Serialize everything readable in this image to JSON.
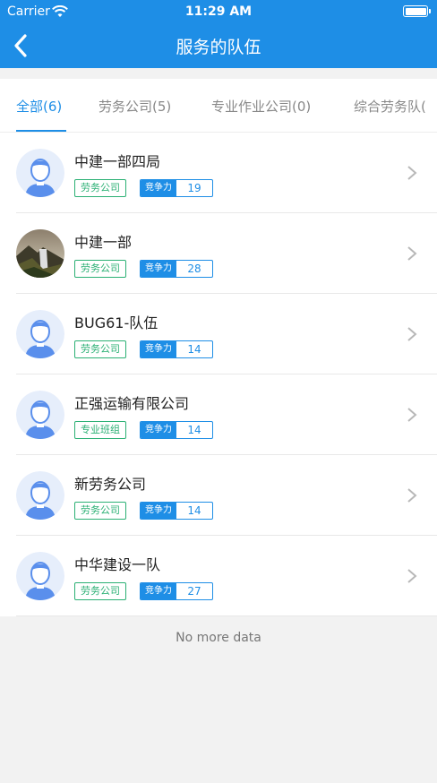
{
  "status_bar": {
    "carrier": "Carrier",
    "time": "11:29 AM"
  },
  "nav": {
    "title": "服务的队伍"
  },
  "tabs": [
    {
      "label": "全部(6)",
      "active": true
    },
    {
      "label": "劳务公司(5)",
      "active": false
    },
    {
      "label": "专业作业公司(0)",
      "active": false
    },
    {
      "label": "综合劳务队(",
      "active": false
    }
  ],
  "teams": [
    {
      "name": "中建一部四局",
      "tag": "劳务公司",
      "comp_label": "竞争力",
      "score": "19",
      "avatar": "person-icon"
    },
    {
      "name": "中建一部",
      "tag": "劳务公司",
      "comp_label": "竞争力",
      "score": "28",
      "avatar": "photo"
    },
    {
      "name": "BUG61-队伍",
      "tag": "劳务公司",
      "comp_label": "竞争力",
      "score": "14",
      "avatar": "person-icon"
    },
    {
      "name": "正强运输有限公司",
      "tag": "专业班组",
      "comp_label": "竞争力",
      "score": "14",
      "avatar": "person-icon"
    },
    {
      "name": "新劳务公司",
      "tag": "劳务公司",
      "comp_label": "竞争力",
      "score": "14",
      "avatar": "person-icon"
    },
    {
      "name": "中华建设一队",
      "tag": "劳务公司",
      "comp_label": "竞争力",
      "score": "27",
      "avatar": "person-icon"
    }
  ],
  "footer": {
    "text": "No more data"
  },
  "colors": {
    "primary": "#1e8ee6",
    "tag_green": "#2bb074"
  }
}
